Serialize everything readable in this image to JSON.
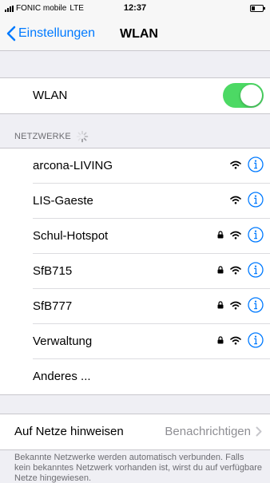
{
  "status_bar": {
    "carrier": "FONIC mobile",
    "network": "LTE",
    "time": "12:37"
  },
  "nav": {
    "back_label": "Einstellungen",
    "title": "WLAN"
  },
  "wlan_toggle": {
    "label": "WLAN",
    "on": true
  },
  "networks_header": "NETZWERKE",
  "networks": [
    {
      "name": "arcona-LIVING",
      "locked": false
    },
    {
      "name": "LIS-Gaeste",
      "locked": false
    },
    {
      "name": "Schul-Hotspot",
      "locked": true
    },
    {
      "name": "SfB715",
      "locked": true
    },
    {
      "name": "SfB777",
      "locked": true
    },
    {
      "name": "Verwaltung",
      "locked": true
    }
  ],
  "other_network_label": "Anderes ...",
  "ask_to_join": {
    "label": "Auf Netze hinweisen",
    "value": "Benachrichtigen"
  },
  "footer_text": "Bekannte Netzwerke werden automatisch verbunden. Falls kein bekanntes Netzwerk vorhanden ist, wirst du auf verfügbare Netze hingewiesen.",
  "colors": {
    "accent": "#007aff",
    "toggle_on": "#4cd964",
    "background": "#efeff4",
    "secondary_text": "#6d6d72"
  }
}
